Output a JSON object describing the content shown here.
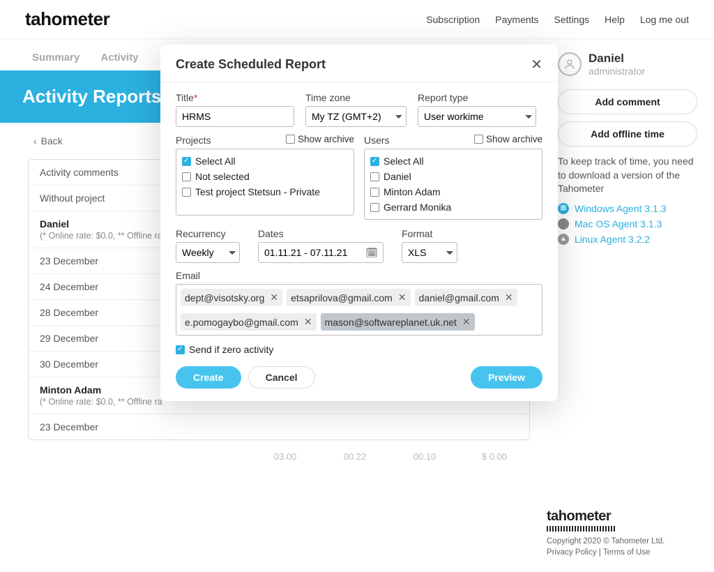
{
  "brand": "tahometer",
  "topnav": {
    "sub": "Subscription",
    "pay": "Payments",
    "set": "Settings",
    "help": "Help",
    "logout": "Log me out"
  },
  "tabs": {
    "summary": "Summary",
    "activity": "Activity"
  },
  "banner": "Activity Reports",
  "back": "Back",
  "list": {
    "r0": "Activity comments",
    "r1": "Without project",
    "r2_name": "Daniel",
    "r2_sub": "(* Online rate: $0.0, ** Offline ra",
    "r3": "23 December",
    "r4": "24 December",
    "r5": "28 December",
    "r6": "29 December",
    "r7": "30 December",
    "r8_name": "Minton Adam",
    "r8_sub": "(* Online rate: $0.0, ** Offline ra",
    "r9": "23 December"
  },
  "ghost": {
    "a": "03.00",
    "b": "00.22",
    "c": "00.10",
    "d": "$ 0.00"
  },
  "sidebar": {
    "user_name": "Daniel",
    "user_role": "administrator",
    "btn_comment": "Add comment",
    "btn_offline": "Add offline time",
    "note": "To keep track of time, you need to download a version of the Tahometer",
    "agent_win": "Windows Agent 3.1.3",
    "agent_mac": "Mac OS Agent 3.1.3",
    "agent_lin": "Linux Agent 3.2.2"
  },
  "footer": {
    "brand": "tahometer",
    "copy": "Copyright 2020 © Tahometer Ltd.",
    "links": "Privacy Policy | Terms of Use"
  },
  "modal": {
    "title": "Create Scheduled Report",
    "lbl_title": "Title",
    "val_title": "HRMS",
    "lbl_tz": "Time zone",
    "val_tz": "My TZ (GMT+2)",
    "lbl_rt": "Report type",
    "val_rt": "User workime",
    "lbl_projects": "Projects",
    "lbl_users": "Users",
    "show_archive": "Show archive",
    "opt_select_all": "Select All",
    "opt_not_selected": "Not selected",
    "opt_test_project": "Test project Stetsun - Private",
    "opt_user1": "Daniel",
    "opt_user2": "Minton Adam",
    "opt_user3": "Gerrard Monika",
    "lbl_rec": "Recurrency",
    "val_rec": "Weekly",
    "lbl_dates": "Dates",
    "val_dates": "01.11.21 - 07.11.21",
    "lbl_fmt": "Format",
    "val_fmt": "XLS",
    "lbl_email": "Email",
    "email1": "dept@visotsky.org",
    "email2": "etsaprilova@gmail.com",
    "email3": "daniel@gmail.com",
    "email4": "e.pomogaybo@gmail.com",
    "email5": "mason@softwareplanet.uk.net",
    "cb_zero": "Send if zero activity",
    "btn_create": "Create",
    "btn_cancel": "Cancel",
    "btn_preview": "Preview"
  }
}
